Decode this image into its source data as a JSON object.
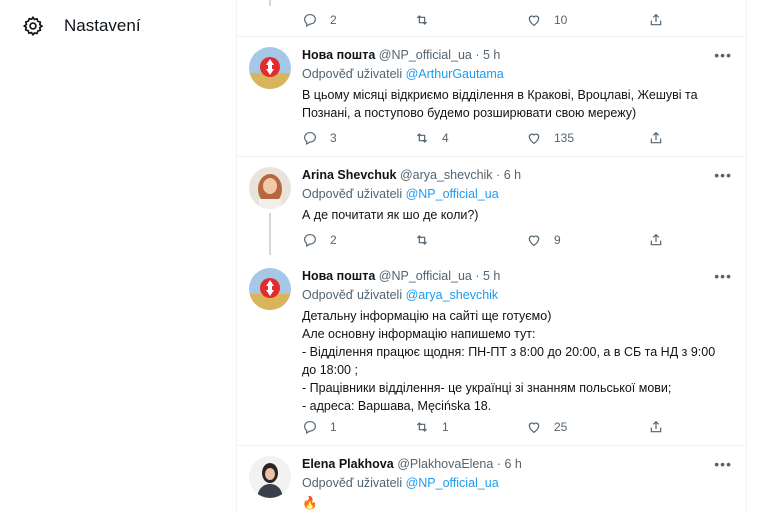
{
  "sidebar": {
    "settings_label": "Nastavení"
  },
  "top_actions": {
    "reply_count": "2",
    "retweet_count": "",
    "like_count": "10"
  },
  "tweets": [
    {
      "name": "Нова пошта",
      "handle": "@NP_official_ua",
      "time": "5 h",
      "reply_prefix": "Odpověď uživateli",
      "reply_to": "@ArthurGautama",
      "lines": [
        "В цьому місяці відкриємо відділення в Кракові, Вроцлаві, Жешуві та",
        "Познані, а поступово будемо розширювати свою мережу)"
      ],
      "replies": "3",
      "retweets": "4",
      "likes": "135"
    },
    {
      "name": "Arina Shevchuk",
      "handle": "@arya_shevchik",
      "time": "6 h",
      "reply_prefix": "Odpověď uživateli",
      "reply_to": "@NP_official_ua",
      "lines": [
        "А де почитати як шо де коли?)"
      ],
      "replies": "2",
      "retweets": "",
      "likes": "9"
    },
    {
      "name": "Нова пошта",
      "handle": "@NP_official_ua",
      "time": "5 h",
      "reply_prefix": "Odpověď uživateli",
      "reply_to": "@arya_shevchik",
      "lines": [
        "Детальну інформацію на сайті ще готуємо)",
        "Але основну інформацію напишемо тут:",
        "- Відділення працює щодня: ПН-ПТ з 8:00 до 20:00,  а в СБ та НД з 9:00",
        "до 18:00 ;",
        "- Працівники відділення- це українці зі знанням польської мови;",
        "- адреса: Варшава, Męcińska 18."
      ],
      "replies": "1",
      "retweets": "1",
      "likes": "25"
    },
    {
      "name": "Elena Plakhova",
      "handle": "@PlakhovaElena",
      "time": "6 h",
      "reply_prefix": "Odpověď uživateli",
      "reply_to": "@NP_official_ua",
      "lines": [
        "🔥"
      ]
    }
  ],
  "icons": {
    "settings": "gear-icon",
    "reply": "reply-icon",
    "retweet": "retweet-icon",
    "like": "heart-icon",
    "share": "share-icon",
    "more": "more-icon"
  },
  "colors": {
    "link": "#1d9bf0",
    "muted": "#536471",
    "text": "#0f1419",
    "border": "#eff3f4"
  }
}
